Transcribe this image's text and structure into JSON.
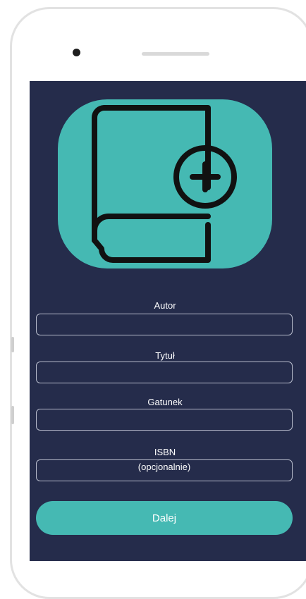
{
  "form": {
    "author_label": "Autor",
    "title_label": "Tytuł",
    "genre_label": "Gatunek",
    "isbn_label": "ISBN",
    "isbn_placeholder": "(opcjonalnie)",
    "author_value": "",
    "title_value": "",
    "genre_value": "",
    "isbn_value": ""
  },
  "actions": {
    "next_label": "Dalej"
  },
  "logo": {
    "icon": "book-add-icon"
  },
  "colors": {
    "screen_background": "#252c4b",
    "accent": "#45b9b3",
    "text": "#ffffff",
    "field_border": "#b8bccc"
  }
}
